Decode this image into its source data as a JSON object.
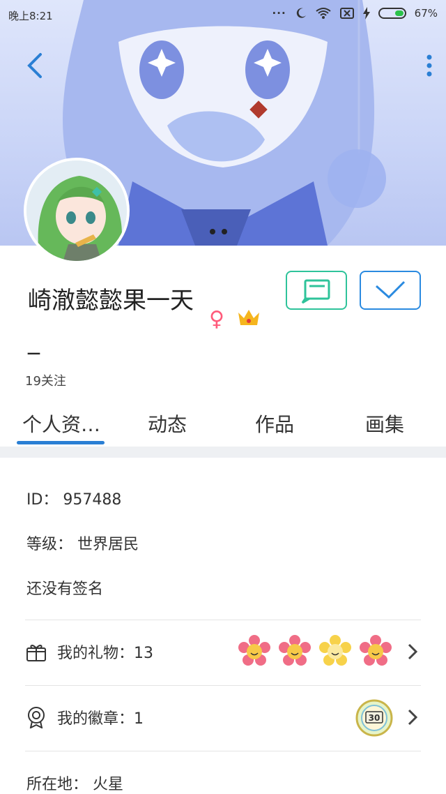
{
  "status_bar": {
    "time": "晚上8:21",
    "battery": "67%"
  },
  "profile": {
    "name": "崎澈懿懿果一天_",
    "gender_symbol": "♀",
    "follow_count": "19关注"
  },
  "tabs": [
    {
      "label": "个人资…"
    },
    {
      "label": "动态"
    },
    {
      "label": "作品"
    },
    {
      "label": "画集"
    }
  ],
  "info": {
    "id": "ID： 957488",
    "level": "等级： 世界居民",
    "signature": "还没有签名"
  },
  "gifts": {
    "label": "我的礼物：13",
    "flowers": [
      "pink",
      "pink",
      "yellow",
      "pink"
    ]
  },
  "badges": {
    "label": "我的徽章：1",
    "medal_text": "30"
  },
  "location": {
    "label": "所在地： 火星"
  },
  "colors": {
    "accent": "#2a7fd4",
    "message_border": "#2ec39a",
    "follow_border": "#2a8ae0"
  }
}
